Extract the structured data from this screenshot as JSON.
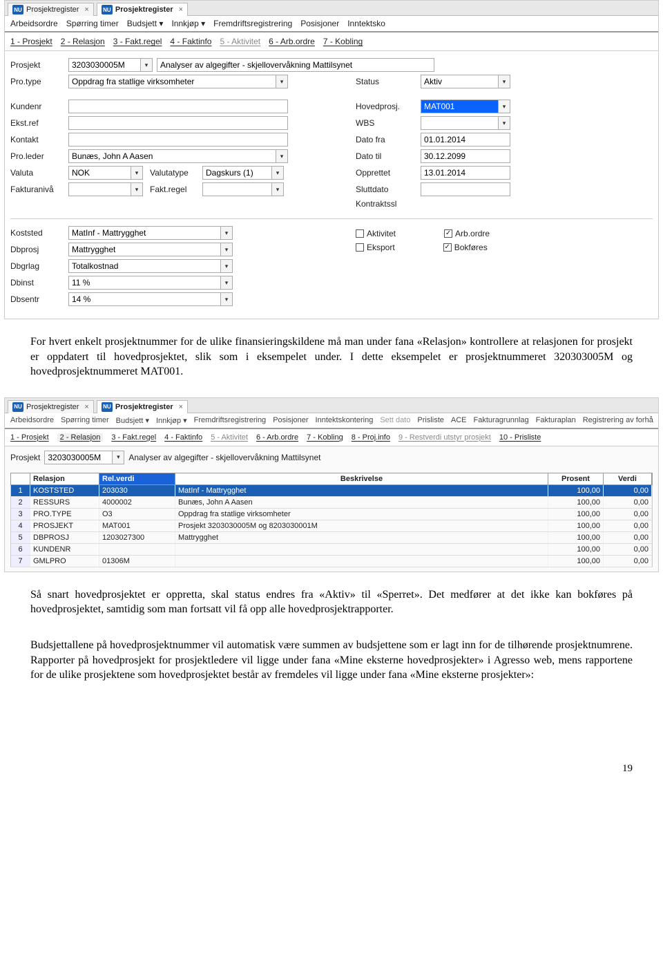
{
  "shot1": {
    "tabs": [
      "Prosjektregister",
      "Prosjektregister"
    ],
    "menu": [
      "Arbeidsordre",
      "Spørring timer",
      "Budsjett ▾",
      "Innkjøp ▾",
      "Fremdriftsregistrering",
      "Posisjoner",
      "Inntektsko"
    ],
    "subtabs": [
      "1 - Prosjekt",
      "2 - Relasjon",
      "3 - Fakt.regel",
      "4 - Faktinfo",
      "5 - Aktivitet",
      "6 - Arb.ordre",
      "7 - Kobling"
    ],
    "labels": {
      "prosjekt": "Prosjekt",
      "protype": "Pro.type",
      "kundenr": "Kundenr",
      "ekstref": "Ekst.ref",
      "kontakt": "Kontakt",
      "proleder": "Pro.leder",
      "valuta": "Valuta",
      "fakturaniva": "Fakturanivå",
      "valutatype": "Valutatype",
      "faktregel": "Fakt.regel",
      "status": "Status",
      "hovedprosj": "Hovedprosj.",
      "wbs": "WBS",
      "datofra": "Dato fra",
      "datotil": "Dato til",
      "opprettet": "Opprettet",
      "sluttdato": "Sluttdato",
      "kontraktsslutt": "Kontraktssl",
      "koststed": "Koststed",
      "dbprosj": "Dbprosj",
      "dbgrlag": "Dbgrlag",
      "dbinst": "Dbinst",
      "dbsentr": "Dbsentr"
    },
    "values": {
      "prosjekt": "3203030005M",
      "prosjekt_name": "Analyser av algegifter - skjellovervåkning Mattilsynet",
      "protype": "Oppdrag fra statlige virksomheter",
      "status": "Aktiv",
      "hovedprosj": "MAT001",
      "datofra": "01.01.2014",
      "datotil": "30.12.2099",
      "opprettet": "13.01.2014",
      "proleder": "Bunæs, John A Aasen",
      "valuta": "NOK",
      "valutatype": "Dagskurs (1)",
      "koststed": "MatInf - Mattrygghet",
      "dbprosj": "Mattrygghet",
      "dbgrlag": "Totalkostnad",
      "dbinst": "11 %",
      "dbsentr": "14 %"
    },
    "checks": {
      "aktivitet": "Aktivitet",
      "arbordre": "Arb.ordre",
      "eksport": "Eksport",
      "bokfores": "Bokføres"
    }
  },
  "para1": "For hvert enkelt prosjektnummer for de ulike finansieringskildene må man under fana «Relasjon» kontrollere at relasjonen for prosjekt er oppdatert til hovedprosjektet, slik som i eksempelet under. I dette eksempelet er prosjektnummeret 320303005M og hovedprosjektnummeret MAT001.",
  "shot2": {
    "tabs": [
      "Prosjektregister",
      "Prosjektregister"
    ],
    "menu": [
      "Arbeidsordre",
      "Spørring timer",
      "Budsjett ▾",
      "Innkjøp ▾",
      "Fremdriftsregistrering",
      "Posisjoner",
      "Inntektskontering",
      "Sett dato",
      "Prisliste",
      "ACE",
      "Fakturagrunnlag",
      "Fakturaplan",
      "Registrering av forhå"
    ],
    "subtabs": [
      "1 - Prosjekt",
      "2 - Relasjon",
      "3 - Fakt.regel",
      "4 - Faktinfo",
      "5 - Aktivitet",
      "6 - Arb.ordre",
      "7 - Kobling",
      "8 - Proj.info",
      "9 - Restverdi utstyr prosjekt",
      "10 - Prisliste"
    ],
    "proj_label": "Prosjekt",
    "proj_id": "3203030005M",
    "proj_name": "Analyser av algegifter - skjellovervåkning Mattilsynet",
    "cols": {
      "num": "",
      "rel": "Relasjon",
      "val": "Rel.verdi",
      "besk": "Beskrivelse",
      "pros": "Prosent",
      "verdi": "Verdi"
    },
    "rows": [
      {
        "n": "1",
        "rel": "KOSTSTED",
        "val": "203030",
        "besk": "MatInf - Mattrygghet",
        "pros": "100,00",
        "verdi": "0,00"
      },
      {
        "n": "2",
        "rel": "RESSURS",
        "val": "4000002",
        "besk": "Bunæs, John A Aasen",
        "pros": "100,00",
        "verdi": "0,00"
      },
      {
        "n": "3",
        "rel": "PRO.TYPE",
        "val": "O3",
        "besk": "Oppdrag fra statlige virksomheter",
        "pros": "100,00",
        "verdi": "0,00"
      },
      {
        "n": "4",
        "rel": "PROSJEKT",
        "val": "MAT001",
        "besk": "Prosjekt 3203030005M og 8203030001M",
        "pros": "100,00",
        "verdi": "0,00"
      },
      {
        "n": "5",
        "rel": "DBPROSJ",
        "val": "1203027300",
        "besk": "Mattrygghet",
        "pros": "100,00",
        "verdi": "0,00"
      },
      {
        "n": "6",
        "rel": "KUNDENR",
        "val": "",
        "besk": "",
        "pros": "100,00",
        "verdi": "0,00"
      },
      {
        "n": "7",
        "rel": "GMLPRO",
        "val": "01306M",
        "besk": "",
        "pros": "100,00",
        "verdi": "0,00"
      }
    ]
  },
  "para2": "Så snart hovedprosjektet er oppretta, skal status endres fra «Aktiv» til «Sperret». Det medfører at det ikke kan bokføres på hovedprosjektet, samtidig som man fortsatt vil få opp alle hovedprosjektrapporter.",
  "para3": "Budsjettallene på hovedprosjektnummer vil automatisk være summen av budsjettene som er lagt inn for de tilhørende prosjektnumrene. Rapporter på hovedprosjekt for prosjektledere vil ligge under fana «Mine eksterne hovedprosjekter» i Agresso web, mens rapportene for de ulike prosjektene som hovedprosjektet består av fremdeles vil ligge under fana «Mine eksterne prosjekter»:",
  "page_number": "19"
}
